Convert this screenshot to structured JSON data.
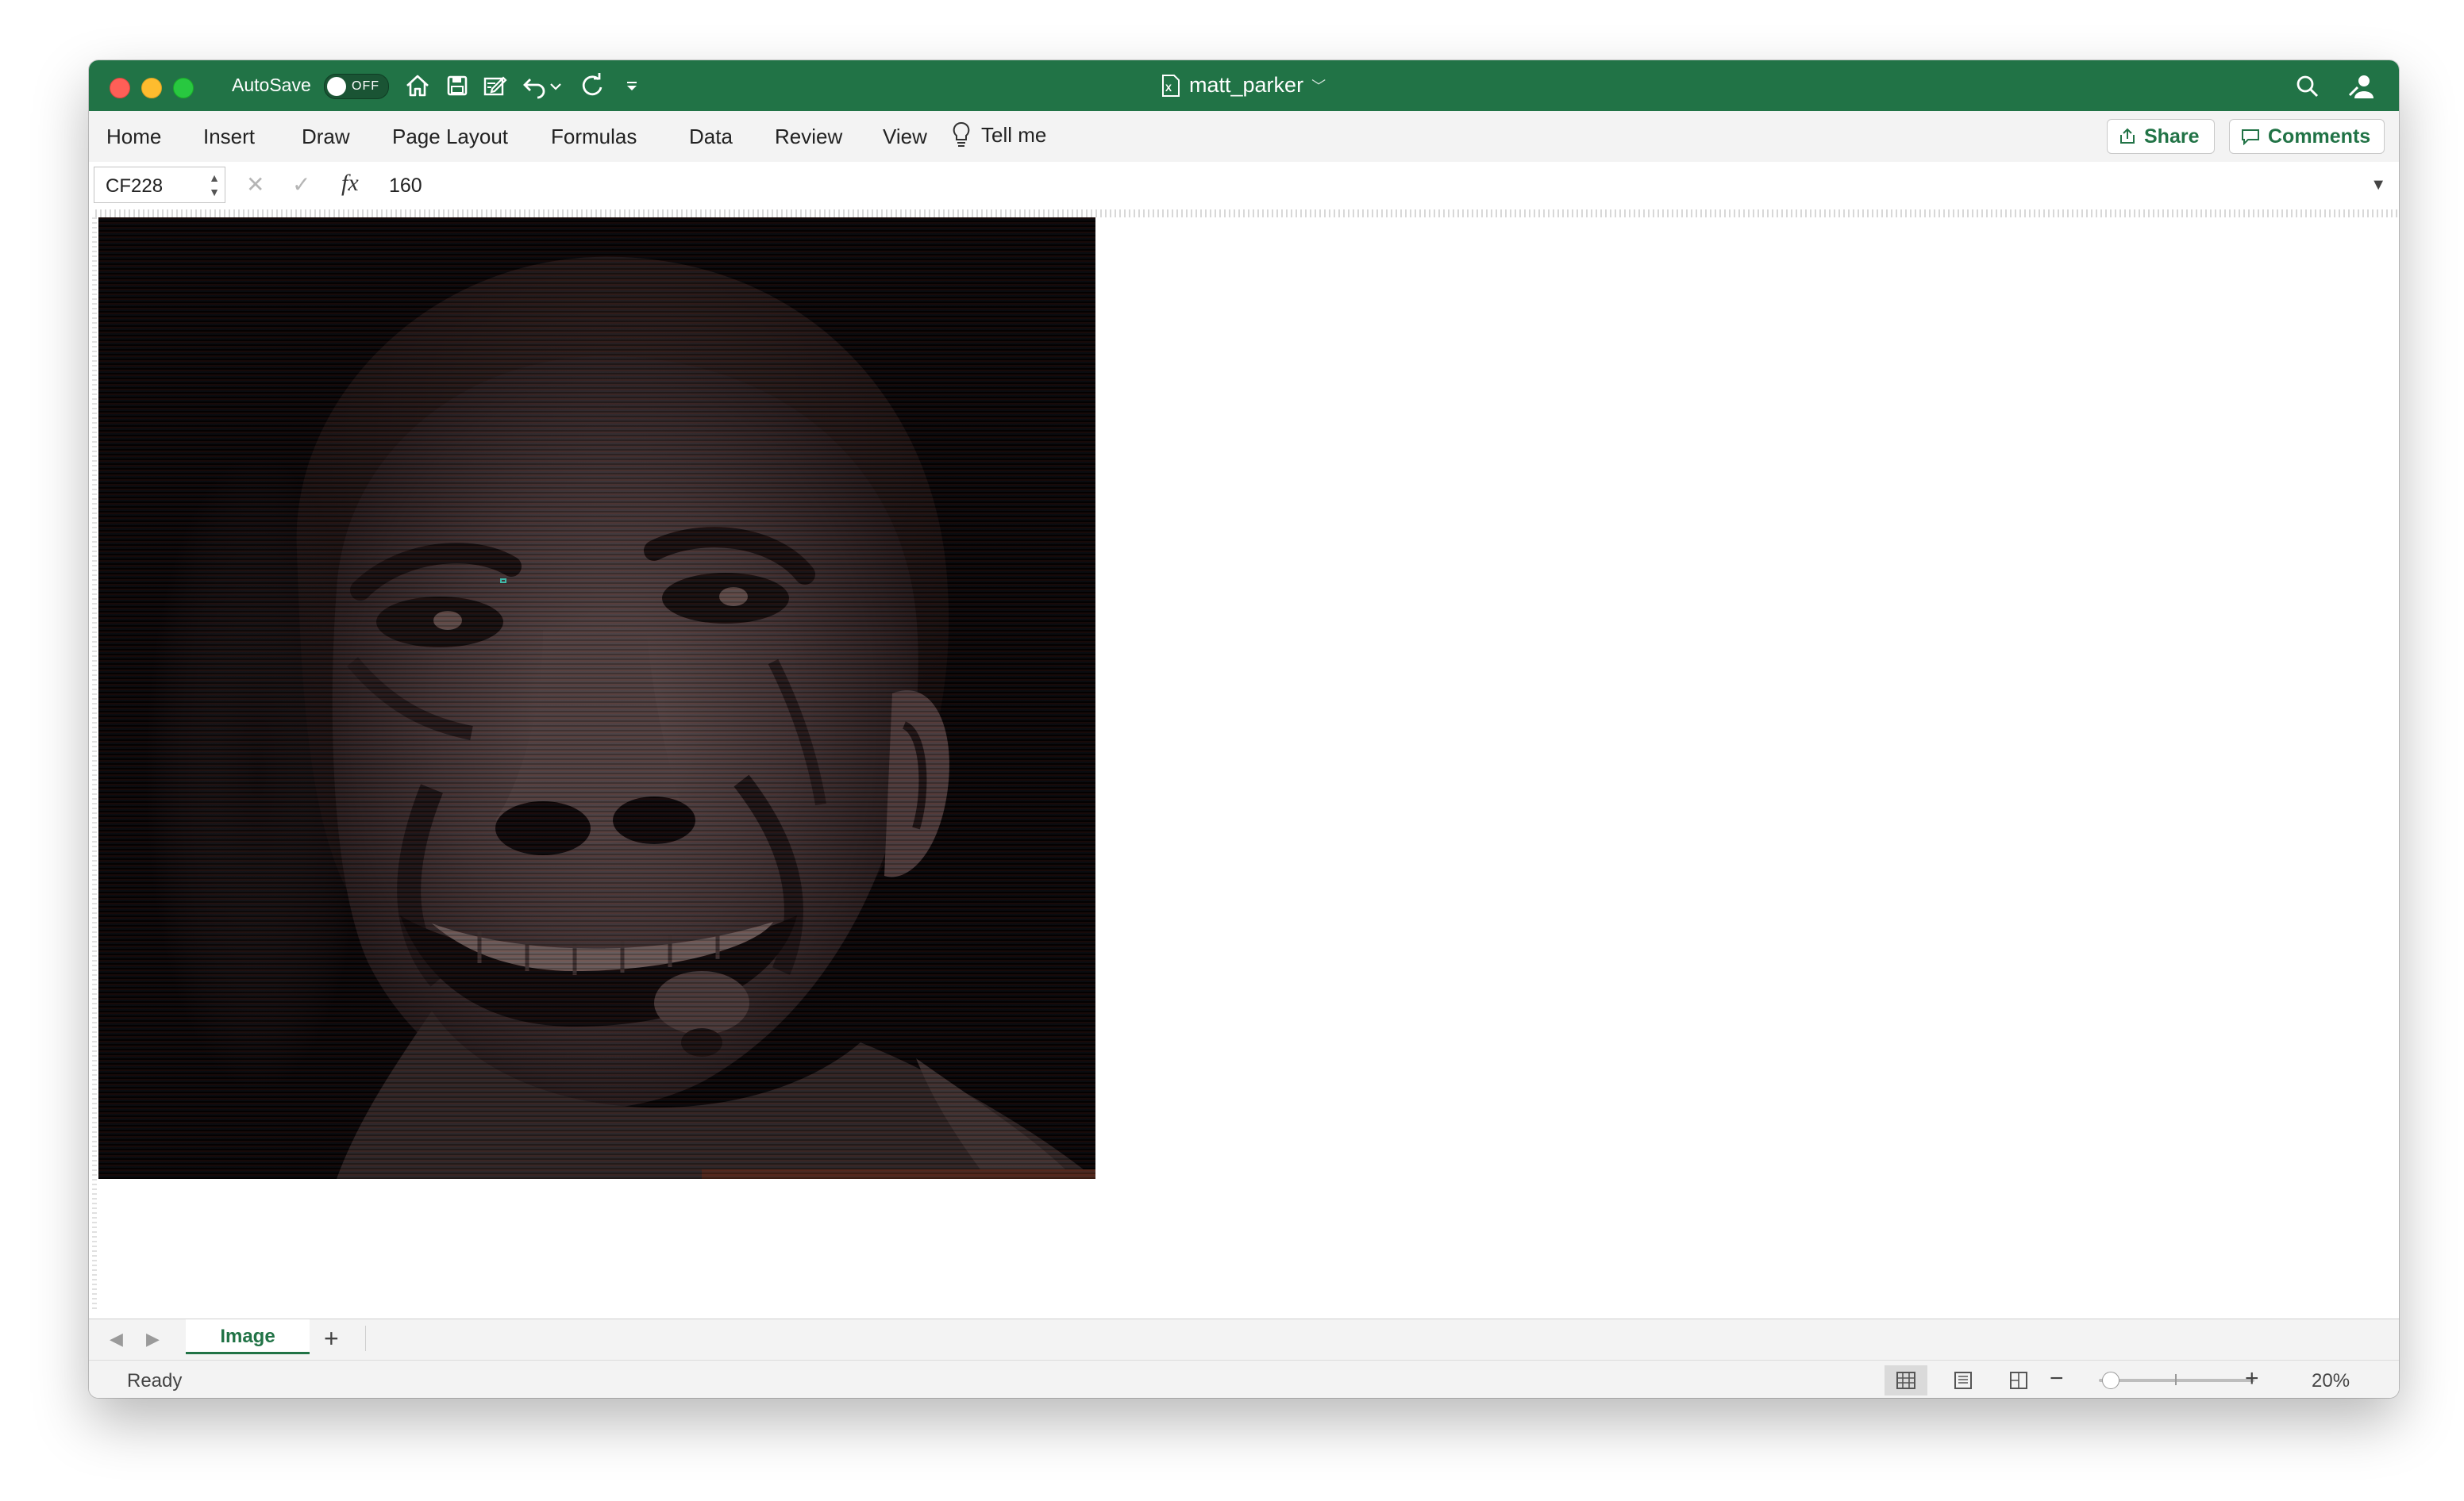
{
  "window": {
    "autosave_label": "AutoSave",
    "autosave_state": "OFF",
    "doc_title": "matt_parker",
    "accent_color": "#217346"
  },
  "toolbar_icons": [
    "home-icon",
    "save-icon",
    "edit-document-icon",
    "undo-icon",
    "undo-dropdown-icon",
    "redo-icon",
    "customize-toolbar-icon"
  ],
  "ribbon": {
    "tabs": [
      "Home",
      "Insert",
      "Draw",
      "Page Layout",
      "Formulas",
      "Data",
      "Review",
      "View",
      "Tell me"
    ],
    "share_label": "Share",
    "comments_label": "Comments"
  },
  "formula_bar": {
    "cell_ref": "CF228",
    "fx_label": "fx",
    "value": "160"
  },
  "sheet": {
    "image_description_icon": "pixel-art-face-image",
    "tabs": [
      {
        "label": "Image",
        "active": true
      }
    ],
    "add_label": "+"
  },
  "status_bar": {
    "status": "Ready",
    "zoom_level": "20%",
    "zoom_fraction": 0.05
  }
}
